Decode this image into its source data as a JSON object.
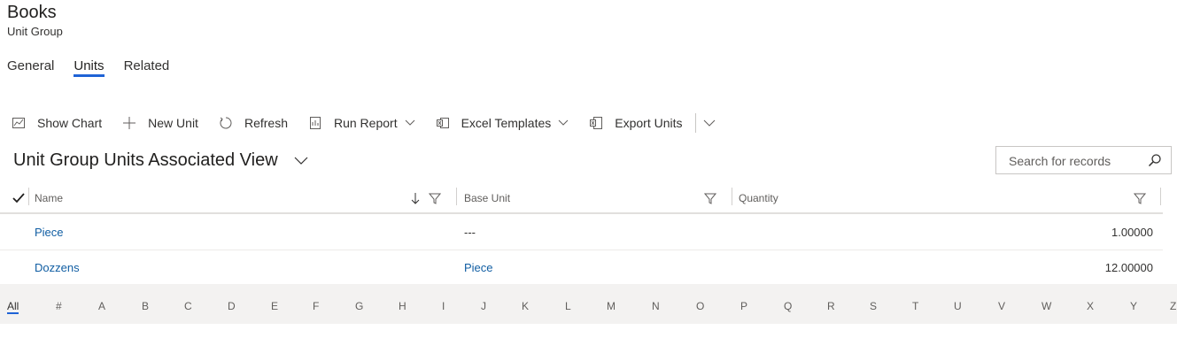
{
  "header": {
    "title": "Books",
    "subtitle": "Unit Group"
  },
  "tabs": [
    {
      "label": "General",
      "active": false
    },
    {
      "label": "Units",
      "active": true
    },
    {
      "label": "Related",
      "active": false
    }
  ],
  "commands": {
    "show_chart": "Show Chart",
    "new_unit": "New Unit",
    "refresh": "Refresh",
    "run_report": "Run Report",
    "excel_templates": "Excel Templates",
    "export_units": "Export Units"
  },
  "view": {
    "title": "Unit Group Units Associated View"
  },
  "search": {
    "placeholder": "Search for records"
  },
  "grid": {
    "columns": {
      "name": "Name",
      "base_unit": "Base Unit",
      "quantity": "Quantity"
    },
    "rows": [
      {
        "name": "Piece",
        "base_unit": "---",
        "quantity": "1.00000"
      },
      {
        "name": "Dozzens",
        "base_unit": "Piece",
        "quantity": "12.00000"
      }
    ]
  },
  "jumpbar": {
    "letters": [
      "All",
      "#",
      "A",
      "B",
      "C",
      "D",
      "E",
      "F",
      "G",
      "H",
      "I",
      "J",
      "K",
      "L",
      "M",
      "N",
      "O",
      "P",
      "Q",
      "R",
      "S",
      "T",
      "U",
      "V",
      "W",
      "X",
      "Y",
      "Z"
    ],
    "active": "All"
  },
  "colors": {
    "accent": "#1f63d6",
    "link": "#115ea3"
  }
}
